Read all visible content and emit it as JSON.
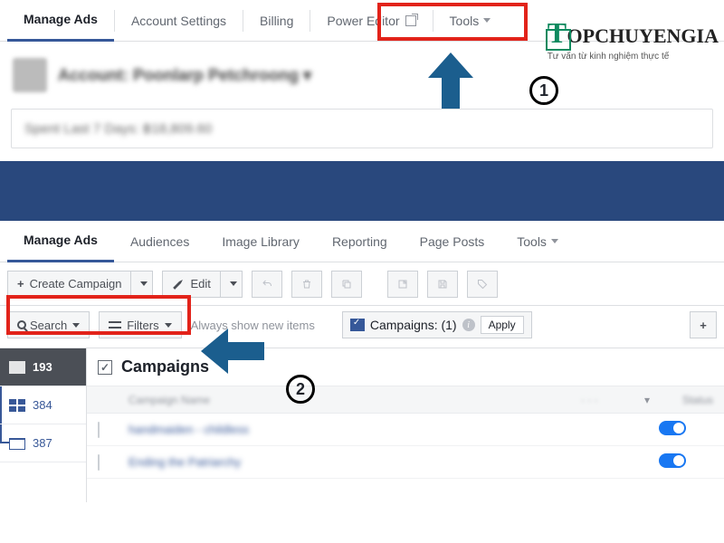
{
  "topnav": {
    "manage_ads": "Manage Ads",
    "account_settings": "Account Settings",
    "billing": "Billing",
    "power_editor": "Power Editor",
    "tools": "Tools"
  },
  "account": {
    "label": "Account:",
    "name": "Poonlarp Petchroong"
  },
  "spend": {
    "text": "Spent Last 7 Days: ฿18,809.60"
  },
  "tabs": {
    "manage_ads": "Manage Ads",
    "audiences": "Audiences",
    "image_library": "Image Library",
    "reporting": "Reporting",
    "page_posts": "Page Posts",
    "tools": "Tools"
  },
  "toolbar": {
    "create_campaign": "Create Campaign",
    "edit": "Edit"
  },
  "filter": {
    "search": "Search",
    "filters": "Filters",
    "always_show": "Always show new items",
    "campaigns_label": "Campaigns: (1)",
    "apply": "Apply"
  },
  "leftnav": {
    "n1": "193",
    "n2": "384",
    "n3": "387"
  },
  "main": {
    "title": "Campaigns",
    "col_name": "Campaign Name",
    "col_status": "Status",
    "row1": "handmaiden - childless",
    "row2": "Ending the Patriarchy"
  },
  "logo": {
    "brand": "TOPCHUYENGIA",
    "tag": "Tư vấn từ kinh nghiệm thực tế"
  },
  "annotations": {
    "step1": "1",
    "step2": "2"
  }
}
